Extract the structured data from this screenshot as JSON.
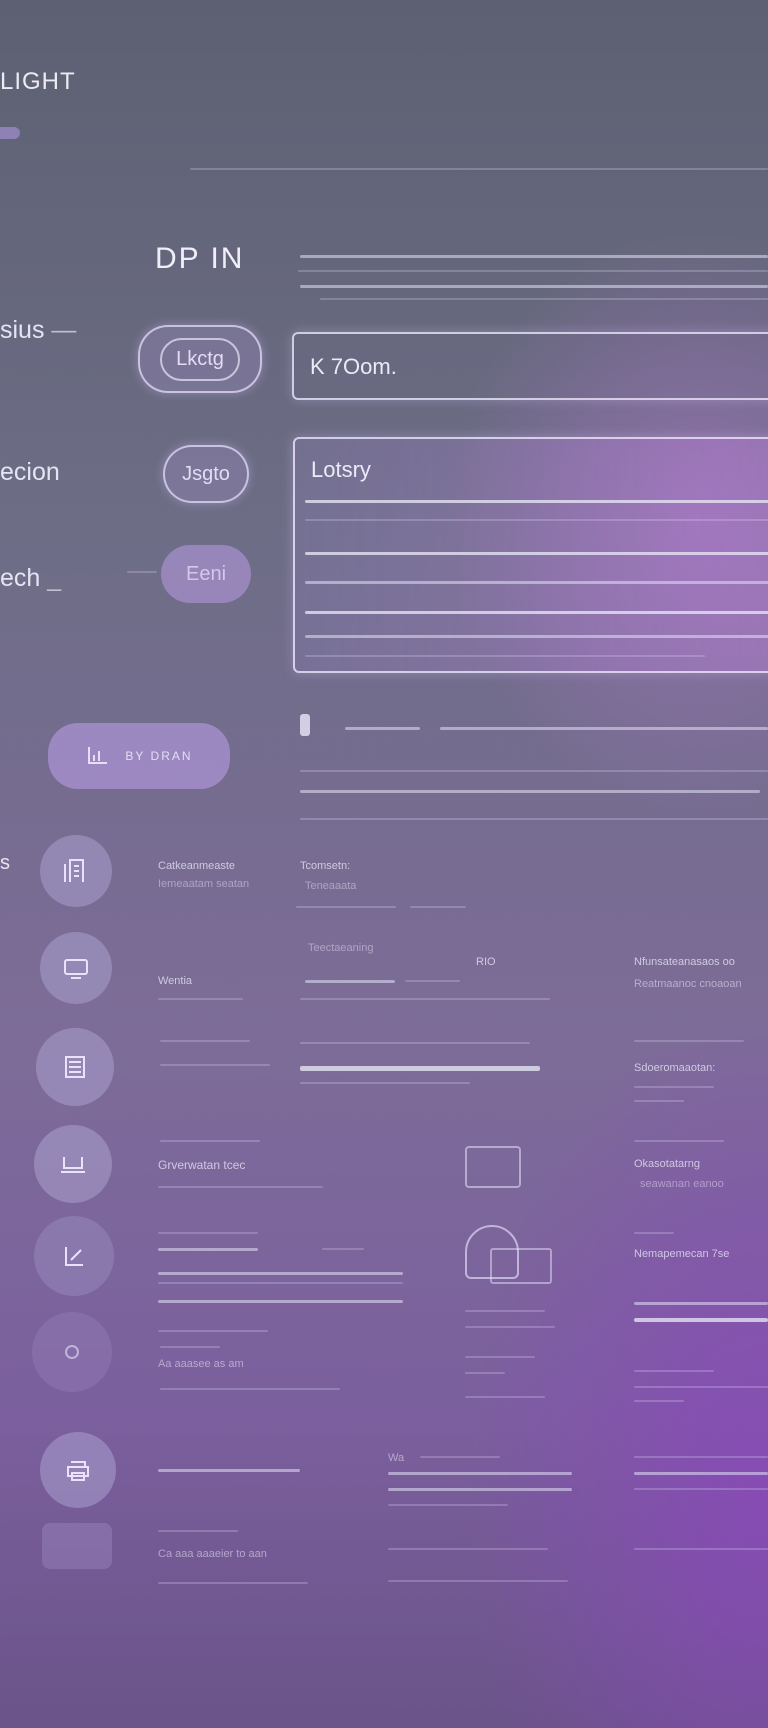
{
  "header": {
    "title": "LIGHT"
  },
  "section": {
    "heading": "DP IN"
  },
  "sidebar": {
    "labels": [
      "sius",
      "ecion",
      "ech"
    ],
    "letter": "s"
  },
  "pills": {
    "first": "Lkctg",
    "second": "Jsgto",
    "third": "Eeni",
    "action": "BY  DRAN"
  },
  "fields": {
    "input_value": "K 7Oom.",
    "textarea_label": "Lotsry"
  },
  "rows": {
    "r1": {
      "left_title": "Catkeanmeaste",
      "left_sub": "Iemeaatam seatan",
      "mid_title": "Tcomsetn:",
      "mid_sub": "Teneaaata"
    },
    "r2": {
      "left_title": "Wentia",
      "mid_title": "Teectaeaning",
      "mid_extra": "RIO",
      "right_title": "Nfunsateanasaos oo",
      "right_sub": "Reatmaanoc  cnoaoan"
    },
    "r3": {
      "right_title": "Sdoeromaaotan:"
    },
    "r4": {
      "left_title": "Grverwatan  tcec",
      "right_title": "Okasotatarng",
      "right_sub": "seawanan  eanoo"
    },
    "r5": {
      "right_title": "Nemapemecan  7se"
    },
    "r6": {
      "left_title": "Aa  aaasee  as  am"
    },
    "r7": {
      "mid_title": "Wa"
    },
    "r8": {
      "left_title": "Ca  aaa   aaaeier  to  aan"
    }
  },
  "colors": {
    "accent": "#b98ae0",
    "text": "#e6e4f2"
  }
}
